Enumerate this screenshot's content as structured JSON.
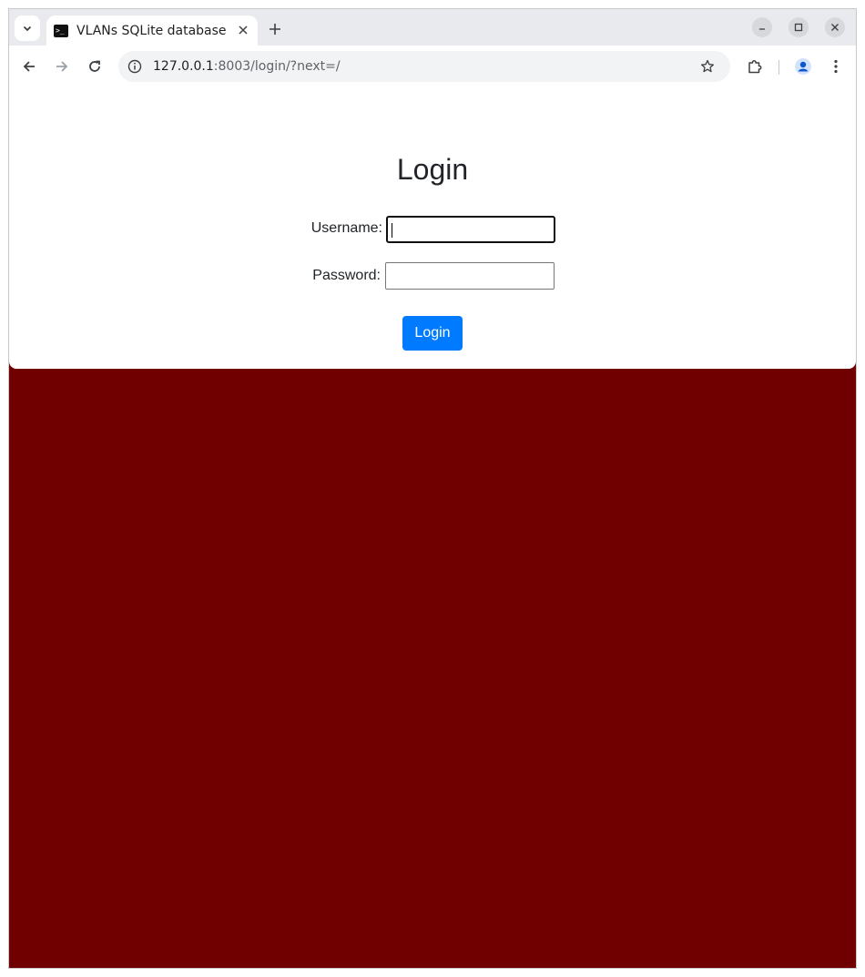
{
  "browser": {
    "tab": {
      "title": "VLANs SQLite database",
      "favicon_icon": "terminal-icon"
    },
    "address": {
      "host": "127.0.0.1",
      "path": ":8003/login/?next=/"
    }
  },
  "page": {
    "background_color": "#700000",
    "heading": "Login",
    "form": {
      "username_label": "Username:",
      "username_value": "",
      "password_label": "Password:",
      "password_value": "",
      "submit_label": "Login",
      "submit_color": "#007bff"
    }
  }
}
